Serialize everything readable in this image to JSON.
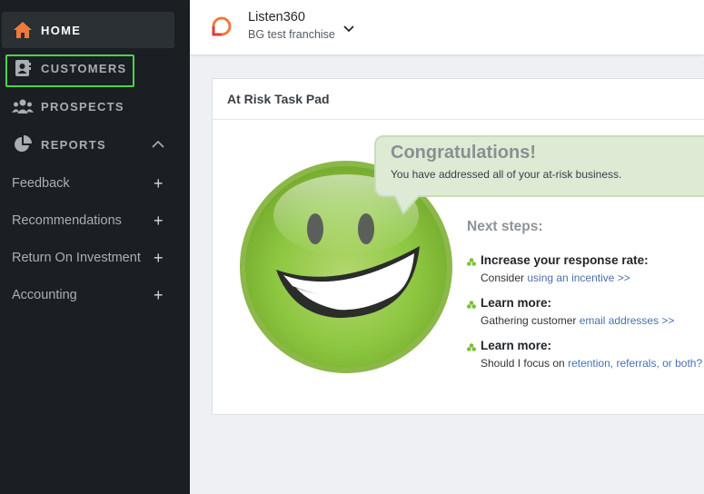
{
  "sidebar": {
    "home": "HOME",
    "customers": "CUSTOMERS",
    "prospects": "PROSPECTS",
    "reports": "REPORTS",
    "sub_items": [
      {
        "label": "Feedback"
      },
      {
        "label": "Recommendations"
      },
      {
        "label": "Return On Investment"
      },
      {
        "label": "Accounting"
      }
    ],
    "plus": "+"
  },
  "header": {
    "brand": "Listen360",
    "franchise": "BG test franchise"
  },
  "card": {
    "title": "At Risk Task Pad",
    "congrats_title": "Congratulations!",
    "congrats_message": "You have addressed all of your at-risk business.",
    "next_steps_label": "Next steps:",
    "steps": [
      {
        "title": "Increase your response rate:",
        "text": "Consider ",
        "link": "using an incentive >>"
      },
      {
        "title": "Learn more:",
        "text": "Gathering customer ",
        "link": "email addresses >>"
      },
      {
        "title": "Learn more:",
        "text": "Should I focus on ",
        "link": "retention, referrals, or both?"
      }
    ]
  },
  "colors": {
    "sidebar_bg": "#1b1f23",
    "accent_orange": "#f07a3a",
    "focus_green": "#4cd34c",
    "link_blue": "#4a6fb0",
    "smiley_green": "#8cc63f"
  }
}
